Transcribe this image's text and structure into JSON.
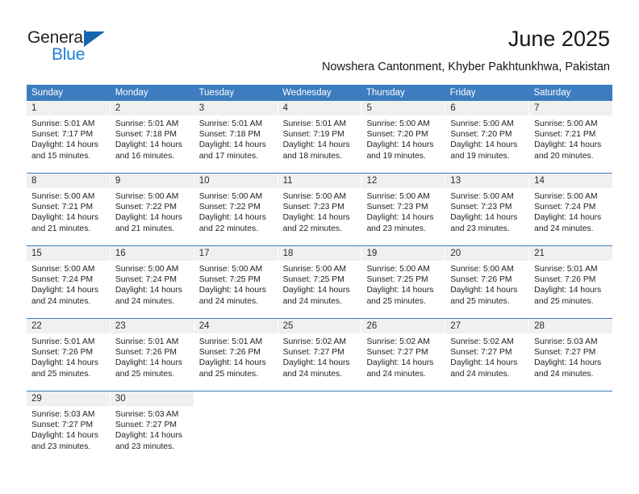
{
  "brand": {
    "name_part1": "General",
    "name_part2": "Blue",
    "triangle_color": "#1565b0",
    "blue_text_color": "#1b7fd4"
  },
  "header": {
    "title": "June 2025",
    "subtitle": "Nowshera Cantonment, Khyber Pakhtunkhwa, Pakistan"
  },
  "theme": {
    "header_blue": "#3c7cbf",
    "day_band_gray": "#f0f0f0",
    "text_dark": "#222222"
  },
  "weekdays": [
    "Sunday",
    "Monday",
    "Tuesday",
    "Wednesday",
    "Thursday",
    "Friday",
    "Saturday"
  ],
  "weeks": [
    {
      "days": [
        {
          "number": "1",
          "sunrise": "Sunrise: 5:01 AM",
          "sunset": "Sunset: 7:17 PM",
          "daylight_line1": "Daylight: 14 hours",
          "daylight_line2": "and 15 minutes."
        },
        {
          "number": "2",
          "sunrise": "Sunrise: 5:01 AM",
          "sunset": "Sunset: 7:18 PM",
          "daylight_line1": "Daylight: 14 hours",
          "daylight_line2": "and 16 minutes."
        },
        {
          "number": "3",
          "sunrise": "Sunrise: 5:01 AM",
          "sunset": "Sunset: 7:18 PM",
          "daylight_line1": "Daylight: 14 hours",
          "daylight_line2": "and 17 minutes."
        },
        {
          "number": "4",
          "sunrise": "Sunrise: 5:01 AM",
          "sunset": "Sunset: 7:19 PM",
          "daylight_line1": "Daylight: 14 hours",
          "daylight_line2": "and 18 minutes."
        },
        {
          "number": "5",
          "sunrise": "Sunrise: 5:00 AM",
          "sunset": "Sunset: 7:20 PM",
          "daylight_line1": "Daylight: 14 hours",
          "daylight_line2": "and 19 minutes."
        },
        {
          "number": "6",
          "sunrise": "Sunrise: 5:00 AM",
          "sunset": "Sunset: 7:20 PM",
          "daylight_line1": "Daylight: 14 hours",
          "daylight_line2": "and 19 minutes."
        },
        {
          "number": "7",
          "sunrise": "Sunrise: 5:00 AM",
          "sunset": "Sunset: 7:21 PM",
          "daylight_line1": "Daylight: 14 hours",
          "daylight_line2": "and 20 minutes."
        }
      ]
    },
    {
      "days": [
        {
          "number": "8",
          "sunrise": "Sunrise: 5:00 AM",
          "sunset": "Sunset: 7:21 PM",
          "daylight_line1": "Daylight: 14 hours",
          "daylight_line2": "and 21 minutes."
        },
        {
          "number": "9",
          "sunrise": "Sunrise: 5:00 AM",
          "sunset": "Sunset: 7:22 PM",
          "daylight_line1": "Daylight: 14 hours",
          "daylight_line2": "and 21 minutes."
        },
        {
          "number": "10",
          "sunrise": "Sunrise: 5:00 AM",
          "sunset": "Sunset: 7:22 PM",
          "daylight_line1": "Daylight: 14 hours",
          "daylight_line2": "and 22 minutes."
        },
        {
          "number": "11",
          "sunrise": "Sunrise: 5:00 AM",
          "sunset": "Sunset: 7:23 PM",
          "daylight_line1": "Daylight: 14 hours",
          "daylight_line2": "and 22 minutes."
        },
        {
          "number": "12",
          "sunrise": "Sunrise: 5:00 AM",
          "sunset": "Sunset: 7:23 PM",
          "daylight_line1": "Daylight: 14 hours",
          "daylight_line2": "and 23 minutes."
        },
        {
          "number": "13",
          "sunrise": "Sunrise: 5:00 AM",
          "sunset": "Sunset: 7:23 PM",
          "daylight_line1": "Daylight: 14 hours",
          "daylight_line2": "and 23 minutes."
        },
        {
          "number": "14",
          "sunrise": "Sunrise: 5:00 AM",
          "sunset": "Sunset: 7:24 PM",
          "daylight_line1": "Daylight: 14 hours",
          "daylight_line2": "and 24 minutes."
        }
      ]
    },
    {
      "days": [
        {
          "number": "15",
          "sunrise": "Sunrise: 5:00 AM",
          "sunset": "Sunset: 7:24 PM",
          "daylight_line1": "Daylight: 14 hours",
          "daylight_line2": "and 24 minutes."
        },
        {
          "number": "16",
          "sunrise": "Sunrise: 5:00 AM",
          "sunset": "Sunset: 7:24 PM",
          "daylight_line1": "Daylight: 14 hours",
          "daylight_line2": "and 24 minutes."
        },
        {
          "number": "17",
          "sunrise": "Sunrise: 5:00 AM",
          "sunset": "Sunset: 7:25 PM",
          "daylight_line1": "Daylight: 14 hours",
          "daylight_line2": "and 24 minutes."
        },
        {
          "number": "18",
          "sunrise": "Sunrise: 5:00 AM",
          "sunset": "Sunset: 7:25 PM",
          "daylight_line1": "Daylight: 14 hours",
          "daylight_line2": "and 24 minutes."
        },
        {
          "number": "19",
          "sunrise": "Sunrise: 5:00 AM",
          "sunset": "Sunset: 7:25 PM",
          "daylight_line1": "Daylight: 14 hours",
          "daylight_line2": "and 25 minutes."
        },
        {
          "number": "20",
          "sunrise": "Sunrise: 5:00 AM",
          "sunset": "Sunset: 7:26 PM",
          "daylight_line1": "Daylight: 14 hours",
          "daylight_line2": "and 25 minutes."
        },
        {
          "number": "21",
          "sunrise": "Sunrise: 5:01 AM",
          "sunset": "Sunset: 7:26 PM",
          "daylight_line1": "Daylight: 14 hours",
          "daylight_line2": "and 25 minutes."
        }
      ]
    },
    {
      "days": [
        {
          "number": "22",
          "sunrise": "Sunrise: 5:01 AM",
          "sunset": "Sunset: 7:26 PM",
          "daylight_line1": "Daylight: 14 hours",
          "daylight_line2": "and 25 minutes."
        },
        {
          "number": "23",
          "sunrise": "Sunrise: 5:01 AM",
          "sunset": "Sunset: 7:26 PM",
          "daylight_line1": "Daylight: 14 hours",
          "daylight_line2": "and 25 minutes."
        },
        {
          "number": "24",
          "sunrise": "Sunrise: 5:01 AM",
          "sunset": "Sunset: 7:26 PM",
          "daylight_line1": "Daylight: 14 hours",
          "daylight_line2": "and 25 minutes."
        },
        {
          "number": "25",
          "sunrise": "Sunrise: 5:02 AM",
          "sunset": "Sunset: 7:27 PM",
          "daylight_line1": "Daylight: 14 hours",
          "daylight_line2": "and 24 minutes."
        },
        {
          "number": "26",
          "sunrise": "Sunrise: 5:02 AM",
          "sunset": "Sunset: 7:27 PM",
          "daylight_line1": "Daylight: 14 hours",
          "daylight_line2": "and 24 minutes."
        },
        {
          "number": "27",
          "sunrise": "Sunrise: 5:02 AM",
          "sunset": "Sunset: 7:27 PM",
          "daylight_line1": "Daylight: 14 hours",
          "daylight_line2": "and 24 minutes."
        },
        {
          "number": "28",
          "sunrise": "Sunrise: 5:03 AM",
          "sunset": "Sunset: 7:27 PM",
          "daylight_line1": "Daylight: 14 hours",
          "daylight_line2": "and 24 minutes."
        }
      ]
    },
    {
      "days": [
        {
          "number": "29",
          "sunrise": "Sunrise: 5:03 AM",
          "sunset": "Sunset: 7:27 PM",
          "daylight_line1": "Daylight: 14 hours",
          "daylight_line2": "and 23 minutes."
        },
        {
          "number": "30",
          "sunrise": "Sunrise: 5:03 AM",
          "sunset": "Sunset: 7:27 PM",
          "daylight_line1": "Daylight: 14 hours",
          "daylight_line2": "and 23 minutes."
        },
        {
          "number": "",
          "sunrise": "",
          "sunset": "",
          "daylight_line1": "",
          "daylight_line2": "",
          "blank": true
        },
        {
          "number": "",
          "sunrise": "",
          "sunset": "",
          "daylight_line1": "",
          "daylight_line2": "",
          "blank": true
        },
        {
          "number": "",
          "sunrise": "",
          "sunset": "",
          "daylight_line1": "",
          "daylight_line2": "",
          "blank": true
        },
        {
          "number": "",
          "sunrise": "",
          "sunset": "",
          "daylight_line1": "",
          "daylight_line2": "",
          "blank": true
        },
        {
          "number": "",
          "sunrise": "",
          "sunset": "",
          "daylight_line1": "",
          "daylight_line2": "",
          "blank": true
        }
      ]
    }
  ]
}
